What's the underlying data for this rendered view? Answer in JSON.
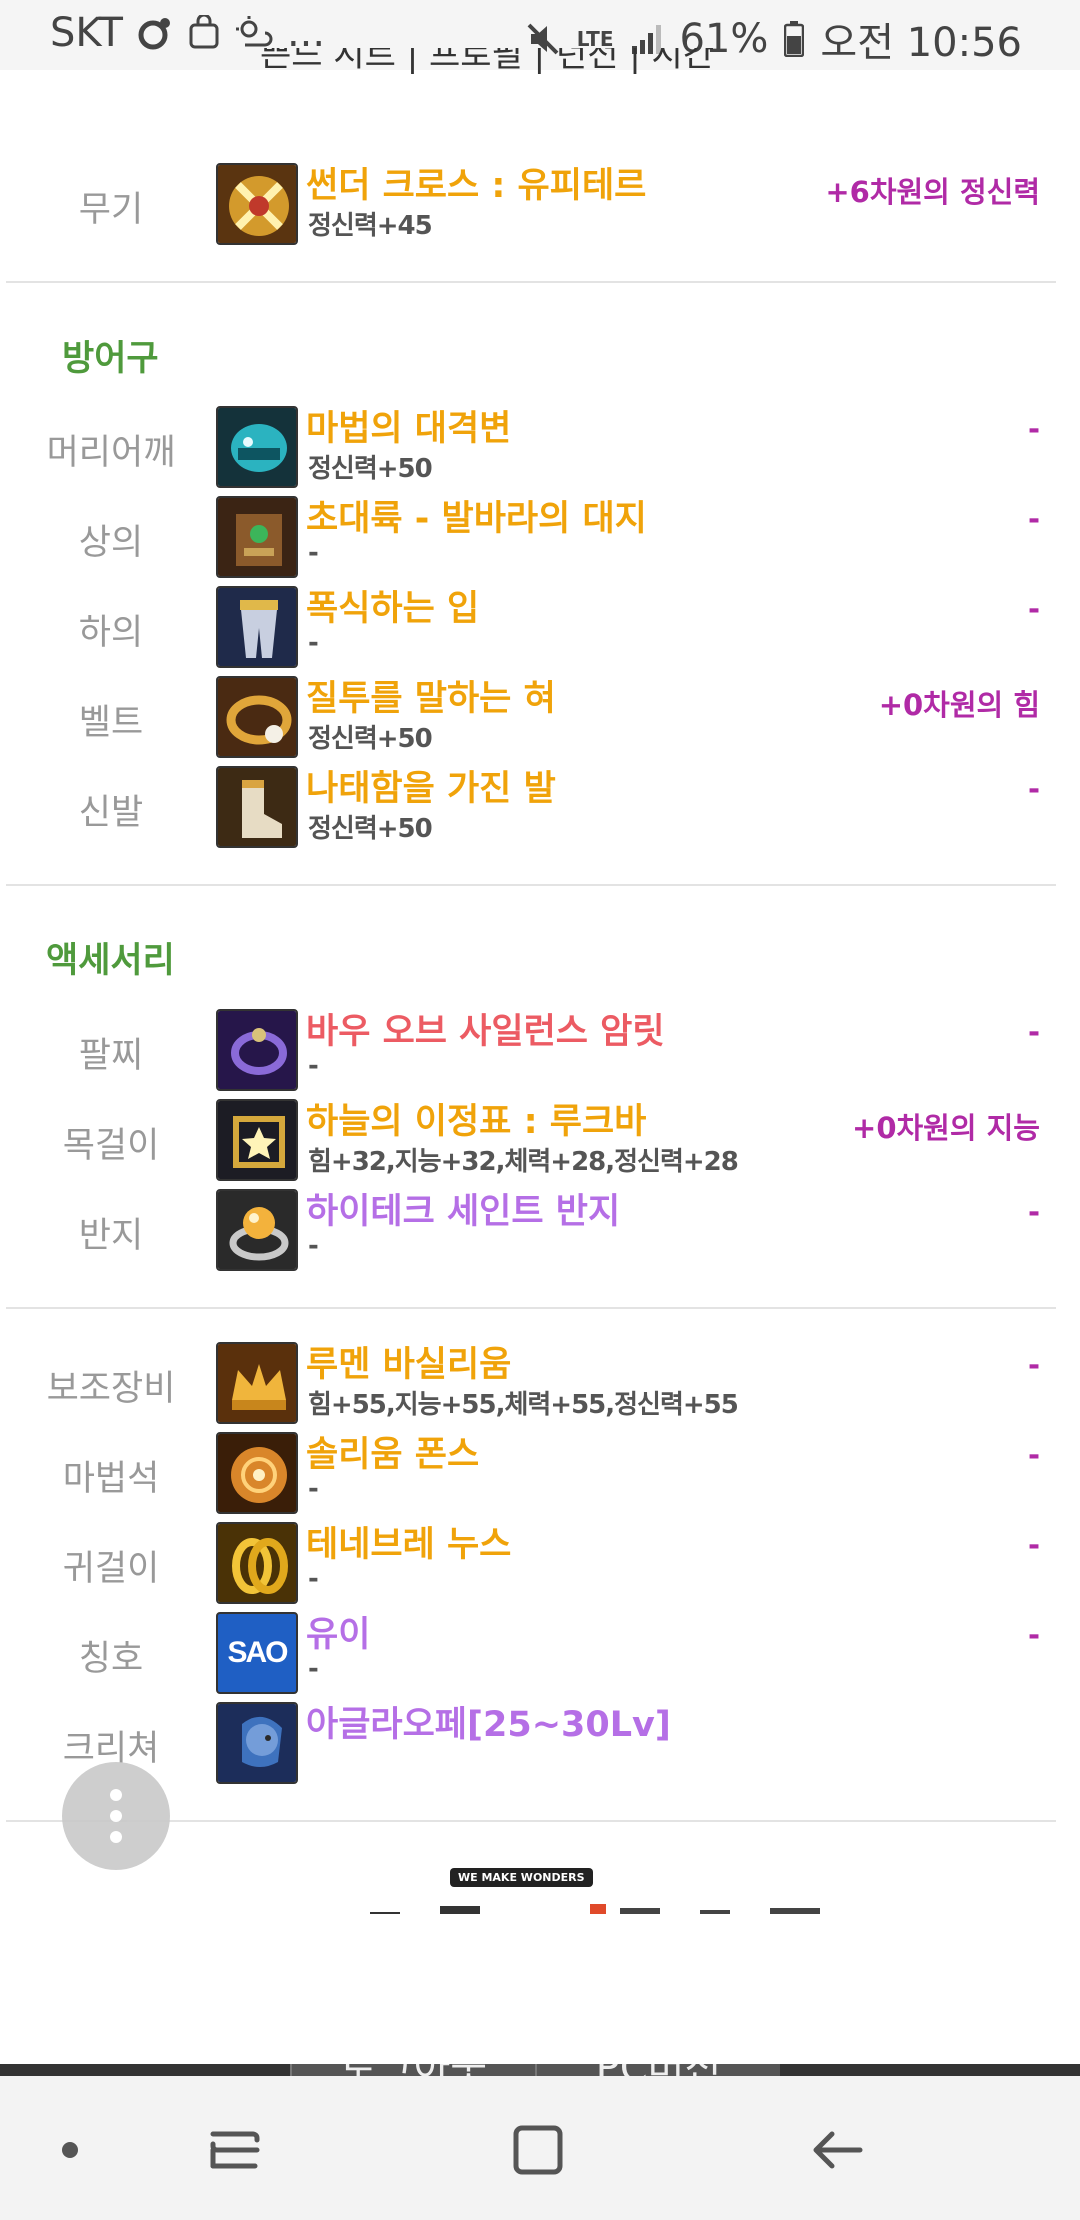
{
  "status": {
    "carrier": "SKT",
    "dots": "...",
    "network": "LTE",
    "battery": "61%",
    "time": "오전 10:56"
  },
  "page": {
    "cutoff_text": "쁜드 시트 | 프로필 | 던전 | 시간"
  },
  "weapon": {
    "label": "무기",
    "name": "썬더 크로스 : 유피테르",
    "stat": "정신력+45",
    "extra": "+6차원의 정신력",
    "icon": "weapon-cross-icon"
  },
  "armor": {
    "title": "방어구",
    "items": [
      {
        "label": "머리어깨",
        "name": "마법의 대격변",
        "stat": "정신력+50",
        "extra": "-",
        "icon": "helmet-icon"
      },
      {
        "label": "상의",
        "name": "초대륙 - 발바라의 대지",
        "stat": "-",
        "extra": "-",
        "icon": "chest-armor-icon"
      },
      {
        "label": "하의",
        "name": "폭식하는 입",
        "stat": "-",
        "extra": "-",
        "icon": "leg-armor-icon"
      },
      {
        "label": "벨트",
        "name": "질투를 말하는 혀",
        "stat": "정신력+50",
        "extra": "+0차원의 힘",
        "icon": "belt-icon"
      },
      {
        "label": "신발",
        "name": "나태함을 가진 발",
        "stat": "정신력+50",
        "extra": "-",
        "icon": "boots-icon"
      }
    ]
  },
  "accessory": {
    "title": "액세서리",
    "items": [
      {
        "label": "팔찌",
        "name": "바우 오브 사일런스 암릿",
        "stat": "-",
        "extra": "-",
        "icon": "bracelet-icon",
        "color": "red"
      },
      {
        "label": "목걸이",
        "name": "하늘의 이정표 : 루크바",
        "stat": "힘+32,지능+32,체력+28,정신력+28",
        "extra": "+0차원의 지능",
        "icon": "necklace-icon",
        "color": "orange"
      },
      {
        "label": "반지",
        "name": "하이테크 세인트 반지",
        "stat": "-",
        "extra": "-",
        "icon": "ring-icon",
        "color": "purple"
      }
    ]
  },
  "special": {
    "items": [
      {
        "label": "보조장비",
        "name": "루멘 바실리움",
        "stat": "힘+55,지능+55,체력+55,정신력+55",
        "extra": "-",
        "icon": "crown-icon",
        "color": "orange"
      },
      {
        "label": "마법석",
        "name": "솔리움 폰스",
        "stat": "-",
        "extra": "-",
        "icon": "magic-stone-icon",
        "color": "orange"
      },
      {
        "label": "귀걸이",
        "name": "테네브레 누스",
        "stat": "-",
        "extra": "-",
        "icon": "earring-icon",
        "color": "orange"
      },
      {
        "label": "칭호",
        "name": "유이",
        "stat": "-",
        "extra": "-",
        "icon": "sao-title-icon",
        "color": "purple"
      },
      {
        "label": "크리쳐",
        "name": "아글라오페[25~30Lv]",
        "stat": "",
        "extra": "",
        "icon": "creature-icon",
        "color": "purple"
      }
    ]
  },
  "banner": {
    "tag": "WE MAKE WONDERS"
  },
  "bottom_tabs": [
    "로그아웃",
    "PC버전"
  ],
  "colors": {
    "orange": "#f0a30a",
    "red": "#ec5b63",
    "purple": "#b56fe6",
    "magenta": "#b02aa6",
    "section_green": "#4f9a3c",
    "label_gray": "#999999"
  }
}
